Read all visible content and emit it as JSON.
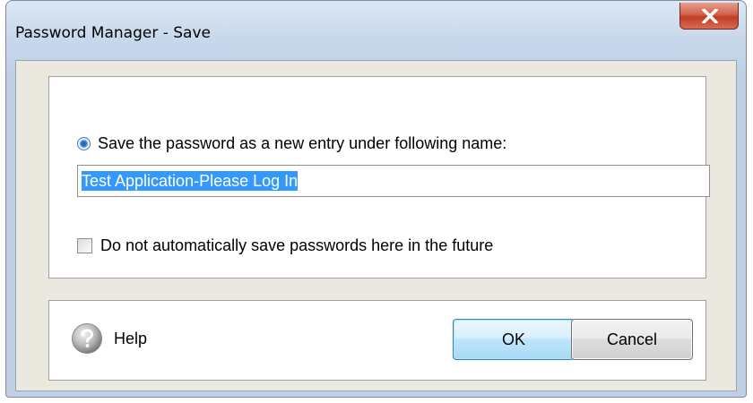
{
  "window": {
    "title": "Password Manager - Save",
    "close_icon": "close-x-icon"
  },
  "options": {
    "radio_label": "Save the password as a new entry under following name:",
    "radio_checked": true,
    "entry_name_value": "Test Application-Please Log In",
    "checkbox_label": "Do not automatically save passwords here in the future",
    "checkbox_checked": false
  },
  "footer": {
    "help_label": "Help",
    "help_icon": "question-mark-icon",
    "ok_label": "OK",
    "cancel_label": "Cancel"
  },
  "colors": {
    "selection": "#3399ff",
    "close_button": "#c23d25",
    "ok_button": "#bee6fd"
  }
}
